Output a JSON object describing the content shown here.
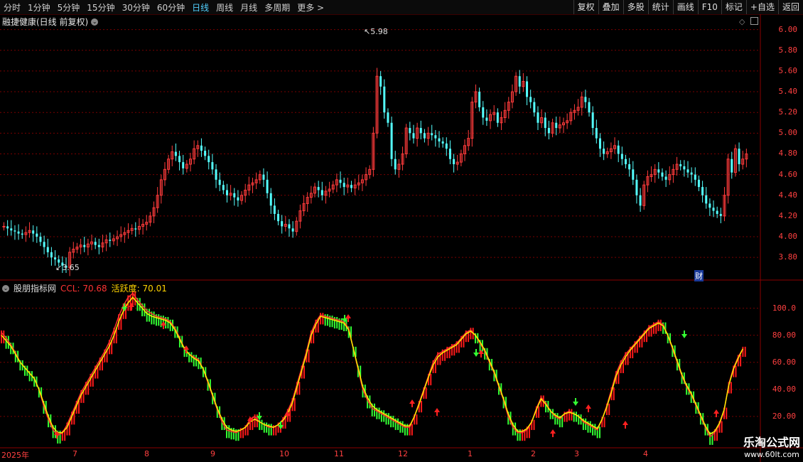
{
  "toolbar": {
    "periods": [
      "分时",
      "1分钟",
      "5分钟",
      "15分钟",
      "30分钟",
      "60分钟",
      "日线",
      "周线",
      "月线",
      "多周期",
      "更多 >"
    ],
    "active_period": "日线",
    "right_buttons": [
      "复权",
      "叠加",
      "多股",
      "统计",
      "画线",
      "F10",
      "标记",
      "+自选",
      "返回"
    ]
  },
  "main_chart": {
    "title": "融捷健康(日线 前复权)",
    "price_axis": [
      "6.00",
      "5.80",
      "5.60",
      "5.40",
      "5.20",
      "5.00",
      "4.80",
      "4.60",
      "4.40",
      "4.20",
      "4.00",
      "3.80"
    ],
    "high_label": "5.98",
    "low_label": "3.65",
    "finance_marker": "财"
  },
  "sub_chart": {
    "title": "股朋指标网",
    "ccl_label": "CCL: 70.68",
    "activity_label": "活跃度: 70.01",
    "axis": [
      "100.0",
      "80.00",
      "60.00",
      "40.00",
      "20.00"
    ]
  },
  "x_axis": {
    "labels": [
      "2025年",
      "7",
      "8",
      "9",
      "10",
      "11",
      "12",
      "1",
      "2",
      "3",
      "4"
    ]
  },
  "watermark": {
    "title": "乐淘公式网",
    "url": "www.60lt.com"
  },
  "chart_data": {
    "type": "candlestick",
    "symbol_title": "融捷健康(日线 前复权)",
    "price_range": [
      3.65,
      5.98
    ],
    "close_series": [
      4.1,
      4.08,
      4.06,
      4.05,
      4.03,
      4.02,
      4.04,
      4.06,
      4.03,
      4.0,
      3.95,
      3.9,
      3.85,
      3.8,
      3.78,
      3.75,
      3.72,
      3.7,
      3.85,
      3.88,
      3.9,
      3.92,
      3.9,
      3.93,
      3.95,
      3.92,
      3.9,
      3.94,
      3.97,
      3.96,
      3.98,
      4.0,
      4.02,
      4.04,
      4.06,
      4.08,
      4.07,
      4.1,
      4.12,
      4.14,
      4.2,
      4.28,
      4.4,
      4.55,
      4.65,
      4.75,
      4.82,
      4.78,
      4.72,
      4.66,
      4.7,
      4.75,
      4.85,
      4.88,
      4.83,
      4.78,
      4.72,
      4.65,
      4.55,
      4.5,
      4.45,
      4.4,
      4.42,
      4.38,
      4.35,
      4.4,
      4.45,
      4.5,
      4.52,
      4.55,
      4.6,
      4.55,
      4.42,
      4.3,
      4.22,
      4.15,
      4.1,
      4.12,
      4.08,
      4.05,
      4.15,
      4.25,
      4.32,
      4.38,
      4.42,
      4.48,
      4.45,
      4.4,
      4.44,
      4.46,
      4.5,
      4.55,
      4.52,
      4.48,
      4.5,
      4.47,
      4.5,
      4.52,
      4.55,
      4.6,
      4.65,
      5.0,
      5.55,
      5.45,
      5.2,
      5.1,
      4.75,
      4.65,
      4.7,
      4.8,
      5.05,
      5.0,
      4.95,
      5.05,
      5.0,
      4.95,
      5.0,
      4.98,
      4.95,
      4.92,
      4.9,
      4.85,
      4.75,
      4.7,
      4.72,
      4.8,
      4.88,
      4.95,
      5.3,
      5.4,
      5.25,
      5.15,
      5.12,
      5.18,
      5.2,
      5.1,
      5.15,
      5.22,
      5.3,
      5.4,
      5.55,
      5.45,
      5.5,
      5.35,
      5.3,
      5.2,
      5.1,
      5.15,
      5.05,
      5.0,
      5.1,
      5.05,
      5.08,
      5.1,
      5.12,
      5.2,
      5.22,
      5.25,
      5.35,
      5.3,
      5.2,
      5.05,
      4.95,
      4.85,
      4.8,
      4.82,
      4.85,
      4.88,
      4.8,
      4.75,
      4.7,
      4.65,
      4.55,
      4.4,
      4.3,
      4.5,
      4.58,
      4.6,
      4.65,
      4.62,
      4.58,
      4.55,
      4.6,
      4.65,
      4.7,
      4.68,
      4.65,
      4.62,
      4.6,
      4.55,
      4.48,
      4.4,
      4.32,
      4.28,
      4.25,
      4.22,
      4.2,
      4.4,
      4.75,
      4.62,
      4.85,
      4.7,
      4.75,
      4.8
    ],
    "ccl_series": [
      82,
      78,
      73,
      67,
      60,
      56,
      52,
      48,
      40,
      28,
      18,
      10,
      6,
      8,
      14,
      22,
      30,
      38,
      44,
      50,
      56,
      62,
      68,
      75,
      84,
      94,
      102,
      108,
      111,
      106,
      102,
      98,
      96,
      94,
      93,
      92,
      90,
      85,
      78,
      70,
      66,
      64,
      62,
      55,
      45,
      35,
      25,
      16,
      10,
      9,
      8,
      10,
      12,
      18,
      20,
      16,
      14,
      12,
      12,
      14,
      18,
      24,
      32,
      44,
      56,
      68,
      82,
      90,
      95,
      94,
      93,
      92,
      91,
      90,
      85,
      70,
      55,
      40,
      32,
      26,
      24,
      22,
      20,
      18,
      16,
      14,
      12,
      12,
      20,
      30,
      40,
      50,
      60,
      66,
      68,
      70,
      72,
      74,
      78,
      82,
      84,
      80,
      74,
      68,
      60,
      52,
      42,
      32,
      20,
      12,
      8,
      8,
      10,
      16,
      26,
      34,
      30,
      24,
      20,
      18,
      22,
      24,
      22,
      20,
      16,
      14,
      12,
      10,
      18,
      28,
      40,
      52,
      60,
      66,
      70,
      74,
      78,
      82,
      86,
      88,
      90,
      88,
      80,
      70,
      60,
      50,
      42,
      36,
      28,
      20,
      12,
      5,
      8,
      14,
      24,
      44,
      56,
      64,
      70
    ],
    "activity_series": [
      80,
      76,
      72,
      66,
      60,
      56,
      52,
      48,
      40,
      30,
      20,
      12,
      8,
      8,
      12,
      20,
      28,
      36,
      42,
      48,
      54,
      60,
      66,
      72,
      80,
      90,
      98,
      104,
      108,
      104,
      100,
      96,
      94,
      93,
      92,
      91,
      89,
      84,
      77,
      70,
      66,
      63,
      61,
      55,
      46,
      36,
      26,
      18,
      12,
      10,
      9,
      10,
      12,
      16,
      18,
      16,
      14,
      13,
      12,
      14,
      17,
      22,
      30,
      42,
      54,
      66,
      80,
      88,
      94,
      93,
      92,
      91,
      90,
      89,
      84,
      70,
      56,
      42,
      34,
      28,
      25,
      23,
      21,
      19,
      17,
      15,
      13,
      13,
      20,
      29,
      39,
      49,
      58,
      64,
      67,
      69,
      71,
      73,
      77,
      81,
      83,
      80,
      75,
      69,
      61,
      53,
      43,
      33,
      22,
      14,
      9,
      9,
      11,
      16,
      25,
      33,
      29,
      24,
      21,
      19,
      22,
      23,
      22,
      20,
      17,
      15,
      13,
      11,
      18,
      27,
      38,
      50,
      58,
      64,
      69,
      73,
      77,
      81,
      85,
      87,
      89,
      87,
      80,
      71,
      61,
      51,
      43,
      37,
      29,
      21,
      13,
      7,
      9,
      15,
      25,
      43,
      55,
      63,
      70
    ]
  }
}
